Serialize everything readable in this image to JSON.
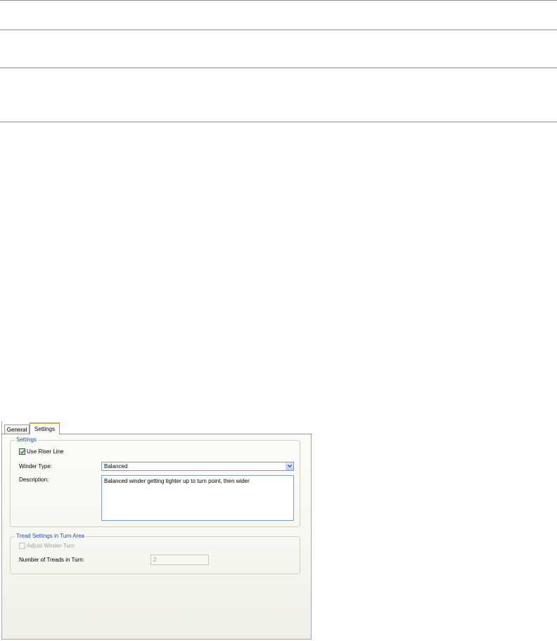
{
  "tabs": [
    {
      "label": "General",
      "active": false
    },
    {
      "label": "Settings",
      "active": true
    }
  ],
  "settings_group": {
    "legend": "Settings",
    "use_riser_line": {
      "label": "Use Riser Line",
      "checked": true
    },
    "winder_type": {
      "label": "Winder Type:",
      "value": "Balanced"
    },
    "description": {
      "label": "Description:",
      "value": "Balanced winder getting tighter up to turn point, then wider"
    }
  },
  "tread_group": {
    "legend": "Tread Settings in Turn Area",
    "adjust_winder_turn": {
      "label": "Adjust Winder Turn",
      "checked": false,
      "enabled": false
    },
    "number_of_treads": {
      "label": "Number of Treads in Turn:",
      "value": "2",
      "enabled": false
    }
  },
  "colors": {
    "accent_tab": "#e6a23a",
    "legend_text": "#1b4fa8"
  }
}
